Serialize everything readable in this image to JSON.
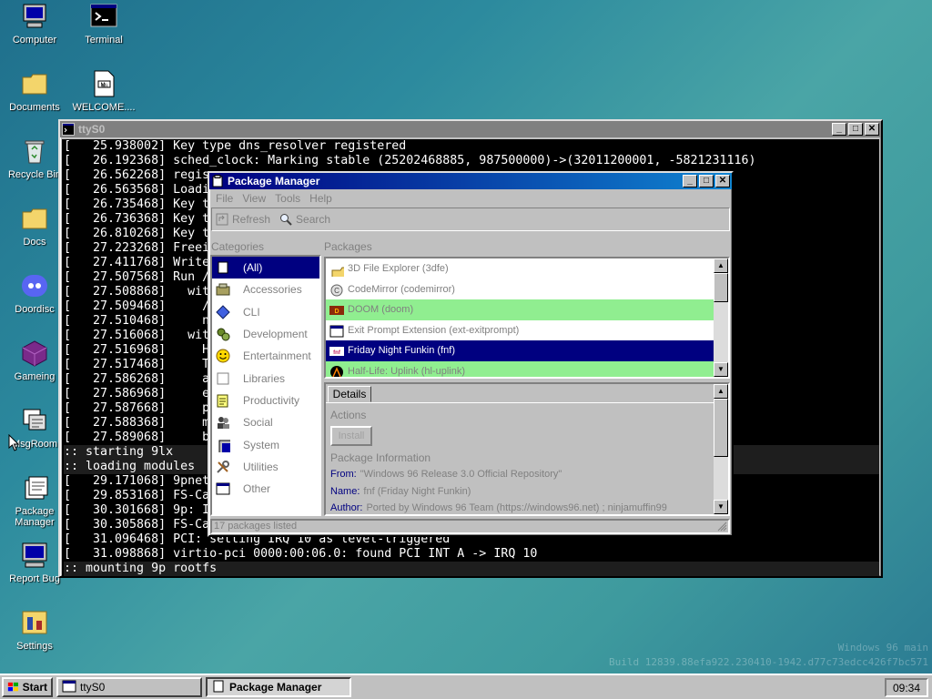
{
  "desktop": {
    "icons": [
      {
        "label": "Computer",
        "icon": "computer-icon"
      },
      {
        "label": "Terminal",
        "icon": "terminal-icon"
      },
      {
        "label": "Documents",
        "icon": "folder-icon"
      },
      {
        "label": "WELCOME....",
        "icon": "document-icon"
      },
      {
        "label": "Recycle Bin",
        "icon": "recycle-bin-icon"
      },
      {
        "label": "Docs",
        "icon": "folder-icon"
      },
      {
        "label": "Doordisc",
        "icon": "discord-icon"
      },
      {
        "label": "Gameing",
        "icon": "cube-icon"
      },
      {
        "label": "MsgRoom",
        "icon": "chat-icon"
      },
      {
        "label": "Package Manager",
        "icon": "package-icon"
      },
      {
        "label": "Report Bug",
        "icon": "monitor-icon"
      },
      {
        "label": "Settings",
        "icon": "settings-icon"
      }
    ],
    "watermark_line1": "Windows 96 main",
    "watermark_line2": "Build 12839.88efa922.230410-1942.d77c73edcc426f7bc571"
  },
  "terminal_window": {
    "title": "ttyS0",
    "lines": [
      "[   25.938002] Key type dns_resolver registered",
      "[   26.192368] sched_clock: Marking stable (25202468885, 987500000)->(32011200001, -5821231116)",
      "[   26.562268] regis",
      "[   26.563568] Loadi",
      "[   26.735468] Key t",
      "[   26.736368] Key t",
      "[   26.810268] Key t",
      "[   27.223268] Freei",
      "[   27.411768] Write",
      "[   27.507568] Run /",
      "[   27.508868]   wit",
      "[   27.509468]     /",
      "[   27.510468]     n",
      "[   27.516068]   wit",
      "[   27.516968]     H",
      "[   27.517468]     T",
      "[   27.586268]     a",
      "[   27.586968]     e",
      "[   27.587668]     p",
      "[   27.588368]     m",
      "[   27.589068]     b",
      ":: starting 9lx",
      ":: loading modules",
      "[   29.171068] 9pnet",
      "[   29.853168] FS-Ca",
      "[   30.301668] 9p: I",
      "[   30.305868] FS-Ca",
      "[   31.096468] PCI: setting IRQ 10 as level-triggered",
      "[   31.098868] virtio-pci 0000:00:06.0: found PCI INT A -> IRQ 10",
      ":: mounting 9p rootfs"
    ]
  },
  "package_manager": {
    "title": "Package Manager",
    "menu": [
      "File",
      "View",
      "Tools",
      "Help"
    ],
    "toolbar": {
      "refresh": "Refresh",
      "search": "Search"
    },
    "categories_label": "Categories",
    "packages_label": "Packages",
    "categories": [
      {
        "label": "(All)",
        "icon": "all-icon",
        "selected": true
      },
      {
        "label": "Accessories",
        "icon": "accessories-icon"
      },
      {
        "label": "CLI",
        "icon": "diamond-icon"
      },
      {
        "label": "Development",
        "icon": "gears-icon"
      },
      {
        "label": "Entertainment",
        "icon": "smiley-icon"
      },
      {
        "label": "Libraries",
        "icon": "library-icon"
      },
      {
        "label": "Productivity",
        "icon": "notepad-icon"
      },
      {
        "label": "Social",
        "icon": "people-icon"
      },
      {
        "label": "System",
        "icon": "computer-icon"
      },
      {
        "label": "Utilities",
        "icon": "tools-icon"
      },
      {
        "label": "Other",
        "icon": "window-icon"
      }
    ],
    "packages": [
      {
        "label": "3D File Explorer (3dfe)",
        "icon": "folder-icon",
        "state": "normal"
      },
      {
        "label": "CodeMirror (codemirror)",
        "icon": "codemirror-icon",
        "state": "normal"
      },
      {
        "label": "DOOM (doom)",
        "icon": "doom-icon",
        "state": "installed"
      },
      {
        "label": "Exit Prompt Extension (ext-exitprompt)",
        "icon": "window-icon",
        "state": "normal"
      },
      {
        "label": "Friday Night Funkin (fnf)",
        "icon": "fnf-icon",
        "state": "selected"
      },
      {
        "label": "Half-Life: Uplink (hl-uplink)",
        "icon": "halflife-icon",
        "state": "installed"
      }
    ],
    "details_tab": "Details",
    "actions_label": "Actions",
    "install_button": "Install",
    "package_info_label": "Package Information",
    "info": [
      {
        "key": "From:",
        "value": "\"Windows 96 Release 3.0 Official Repository\""
      },
      {
        "key": "Name:",
        "value": "fnf (Friday Night Funkin)"
      },
      {
        "key": "Author:",
        "value": "Ported by Windows 96 Team (https://windows96.net) ; ninjamuffin99"
      }
    ],
    "status": "17 packages listed"
  },
  "taskbar": {
    "start": "Start",
    "tasks": [
      {
        "label": "ttyS0",
        "active": false
      },
      {
        "label": "Package Manager",
        "active": true
      }
    ],
    "clock": "09:34"
  },
  "colors": {
    "title_active": "#000080",
    "installed_row": "#90ee90",
    "selected_row": "#000080"
  }
}
